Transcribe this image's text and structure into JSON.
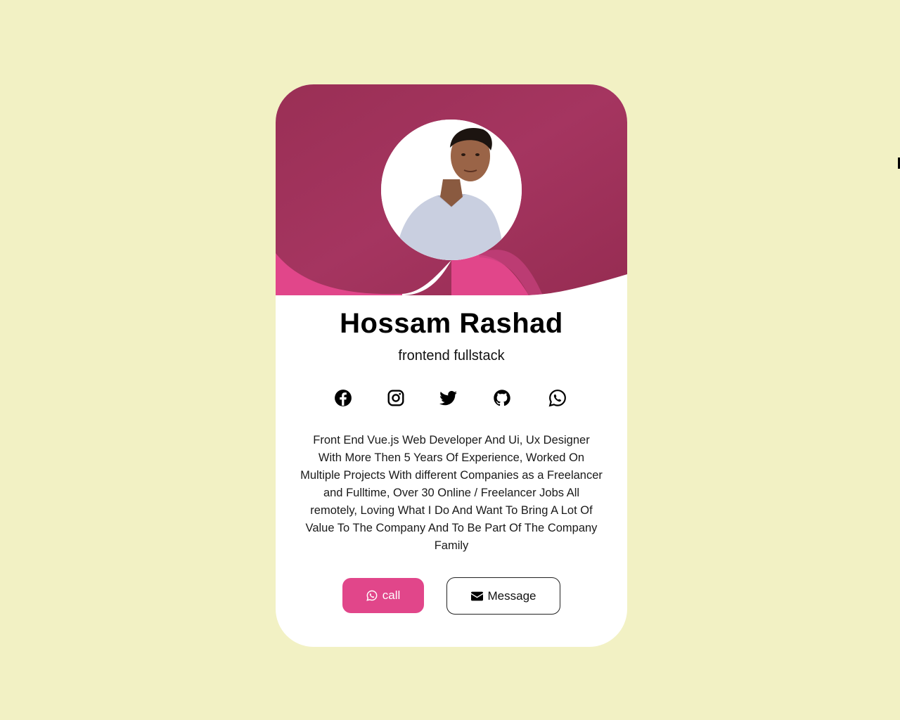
{
  "profile": {
    "name": "Hossam Rashad",
    "role": "frontend fullstack",
    "bio": "Front End Vue.js Web Developer And Ui, Ux Designer With More Then 5 Years Of Experience, Worked On Multiple Projects With different Companies as a Freelancer and Fulltime, Over 30 Online / Freelancer Jobs All remotely, Loving What I Do And Want To Bring A Lot Of Value To The Company And To Be Part Of The Company Family"
  },
  "socials": [
    {
      "icon": "facebook-icon"
    },
    {
      "icon": "instagram-icon"
    },
    {
      "icon": "twitter-icon"
    },
    {
      "icon": "github-icon"
    },
    {
      "icon": "whatsapp-icon"
    }
  ],
  "actions": {
    "call_label": "call",
    "call_icon": "whatsapp-icon",
    "message_label": "Message",
    "message_icon": "envelope-icon"
  },
  "colors": {
    "page_background": "#f2f1c4",
    "banner": "#9b3056",
    "accent": "#e1468a",
    "card": "#ffffff"
  }
}
